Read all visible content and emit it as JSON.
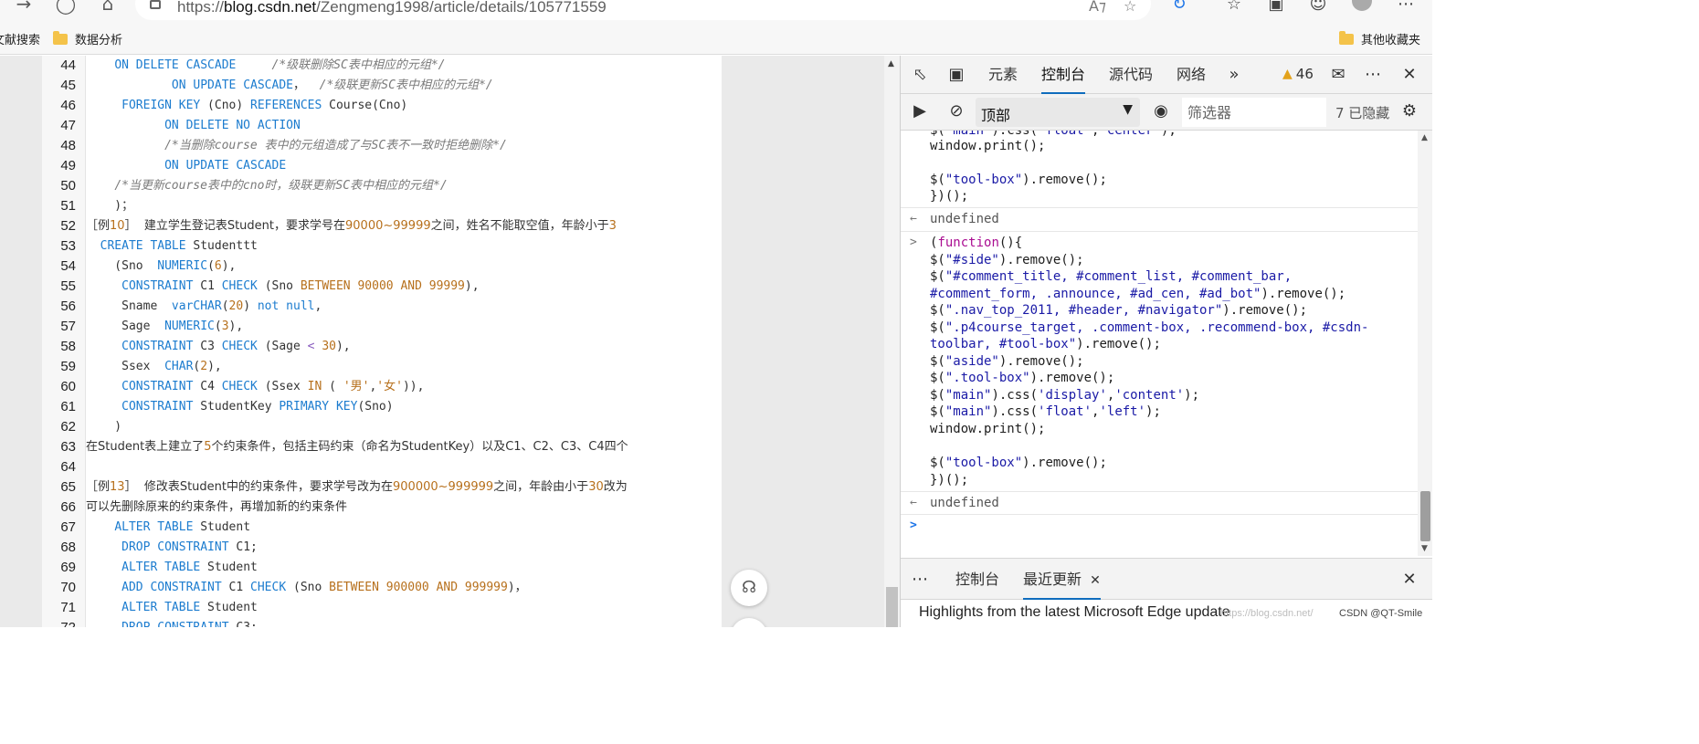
{
  "browser": {
    "url_scheme": "https://",
    "url_host": "blog.csdn.net",
    "url_path": "/Zengmeng1998/article/details/105771559",
    "icons": [
      "back-icon",
      "refresh-icon",
      "home-icon",
      "lock-icon",
      "read-aloud-icon",
      "favorite-star-icon",
      "sync-icon",
      "favorites-icon",
      "collections-icon",
      "profile-icon",
      "more-icon"
    ]
  },
  "bookmarks": {
    "left_partial": "文献搜索",
    "items": [
      "数据分析"
    ],
    "other": "其他收藏夹"
  },
  "article": {
    "line_numbers": [
      "44",
      "45",
      "46",
      "47",
      "48",
      "49",
      "50",
      "51",
      "52",
      "53",
      "54",
      "55",
      "56",
      "57",
      "58",
      "59",
      "60",
      "61",
      "62",
      "63",
      "64",
      "65",
      "66",
      "67",
      "68",
      "69",
      "70",
      "71",
      "72"
    ]
  },
  "devtools": {
    "tabs": [
      "元素",
      "控制台",
      "源代码",
      "网络"
    ],
    "active_tab": "控制台",
    "warning_count": "46",
    "context": "顶部",
    "filter_placeholder": "筛选器",
    "hidden_count": "7 已隐藏",
    "console": {
      "result_1": "undefined",
      "result_2": "undefined"
    },
    "drawer": {
      "tabs": [
        "控制台",
        "最近更新"
      ],
      "active_tab": "最近更新",
      "headline": "Highlights from the latest Microsoft Edge update"
    }
  },
  "watermark": "https://blog.csdn.net/",
  "credit": "CSDN @QT-Smile",
  "colors": {
    "accent": "#0f6cbd",
    "keyword": "#1c7ccf",
    "number": "#b7701c",
    "warning": "#e3a21a"
  }
}
